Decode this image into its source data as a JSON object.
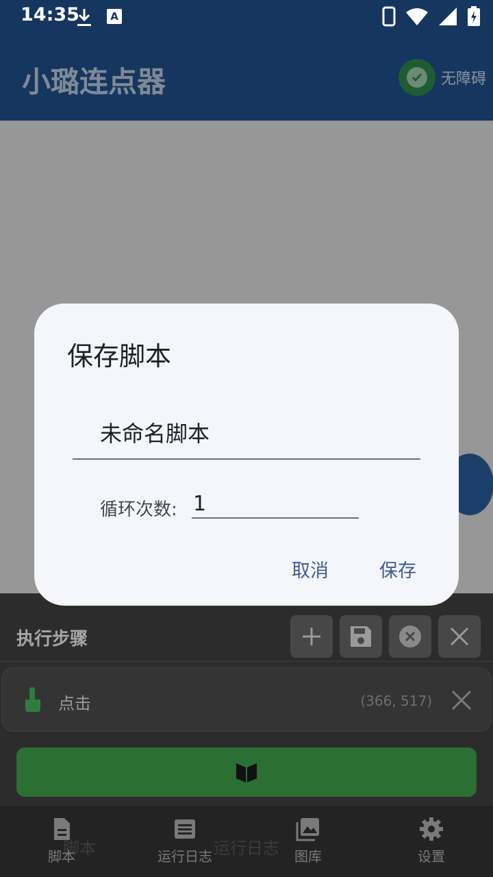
{
  "status_bar": {
    "time": "14:35",
    "a_icon": "A"
  },
  "app_bar": {
    "title": "小璐连点器",
    "accessibility_label": "无障碍"
  },
  "panel": {
    "title": "执行步骤",
    "step": {
      "label": "点击",
      "coords": "(366, 517)"
    }
  },
  "nav": {
    "items": [
      {
        "label": "脚本",
        "icon": "document-icon"
      },
      {
        "label": "运行日志",
        "icon": "log-icon"
      },
      {
        "label": "图库",
        "icon": "gallery-icon"
      },
      {
        "label": "设置",
        "icon": "gear-icon"
      }
    ],
    "ghost_labels": {
      "script": "脚本",
      "log": "运行日志"
    }
  },
  "dialog": {
    "title": "保存脚本",
    "script_name": "未命名脚本",
    "loop_label": "循环次数:",
    "loop_count": "1",
    "cancel_label": "取消",
    "save_label": "保存"
  },
  "colors": {
    "app_bar": "#15365f",
    "dialog_bg": "#f4f6fb",
    "button_text": "#3d5d8c",
    "run_bar": "#2b6f33"
  }
}
